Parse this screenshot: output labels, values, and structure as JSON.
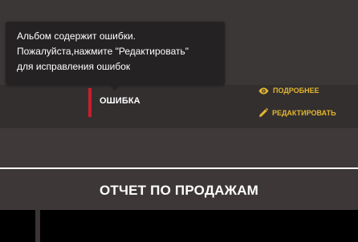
{
  "tooltip": {
    "line1": "Альбом содержит ошибки.",
    "line2": "Пожалуйста,нажмите \"Редактировать\"",
    "line3": "для исправления ошибок"
  },
  "album": {
    "status_label": "ОШИБКА",
    "status_color": "#c6202a"
  },
  "actions": {
    "details_label": "ПОДРОБНЕЕ",
    "details_icon": "eye-icon",
    "edit_label": "РЕДАКТИРОВАТЬ",
    "edit_icon": "pencil-icon",
    "color": "#e2b52f"
  },
  "section": {
    "title": "ОТЧЕТ ПО ПРОДАЖАМ"
  }
}
